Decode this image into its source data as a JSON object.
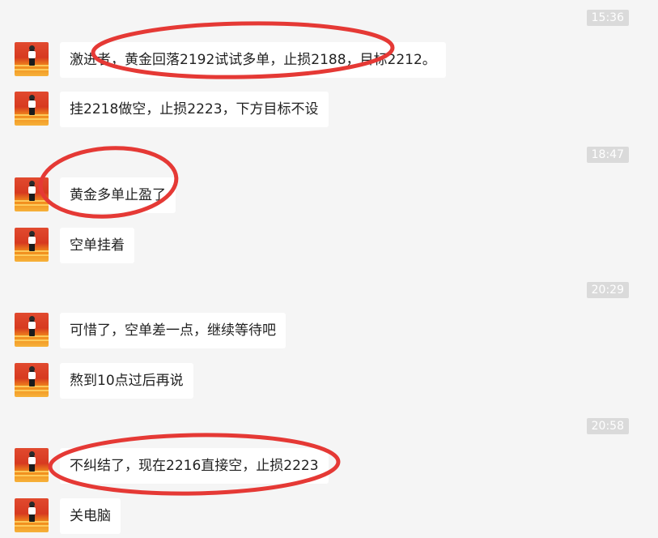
{
  "timestamps": [
    "15:36",
    "18:47",
    "20:29",
    "20:58"
  ],
  "messages": [
    {
      "text": "激进者，黄金回落2192试试多单，止损2188，目标2212。"
    },
    {
      "text": "挂2218做空，止损2223，下方目标不设"
    },
    {
      "text": "黄金多单止盈了"
    },
    {
      "text": "空单挂着"
    },
    {
      "text": "可惜了，空单差一点，继续等待吧"
    },
    {
      "text": "熬到10点过后再说"
    },
    {
      "text": "不纠结了，现在2216直接空，止损2223"
    },
    {
      "text": "关电脑"
    }
  ],
  "colors": {
    "background": "#f5f5f5",
    "bubble": "#ffffff",
    "timestamp_badge": "#dadada",
    "annotation_circle": "#e53935"
  }
}
